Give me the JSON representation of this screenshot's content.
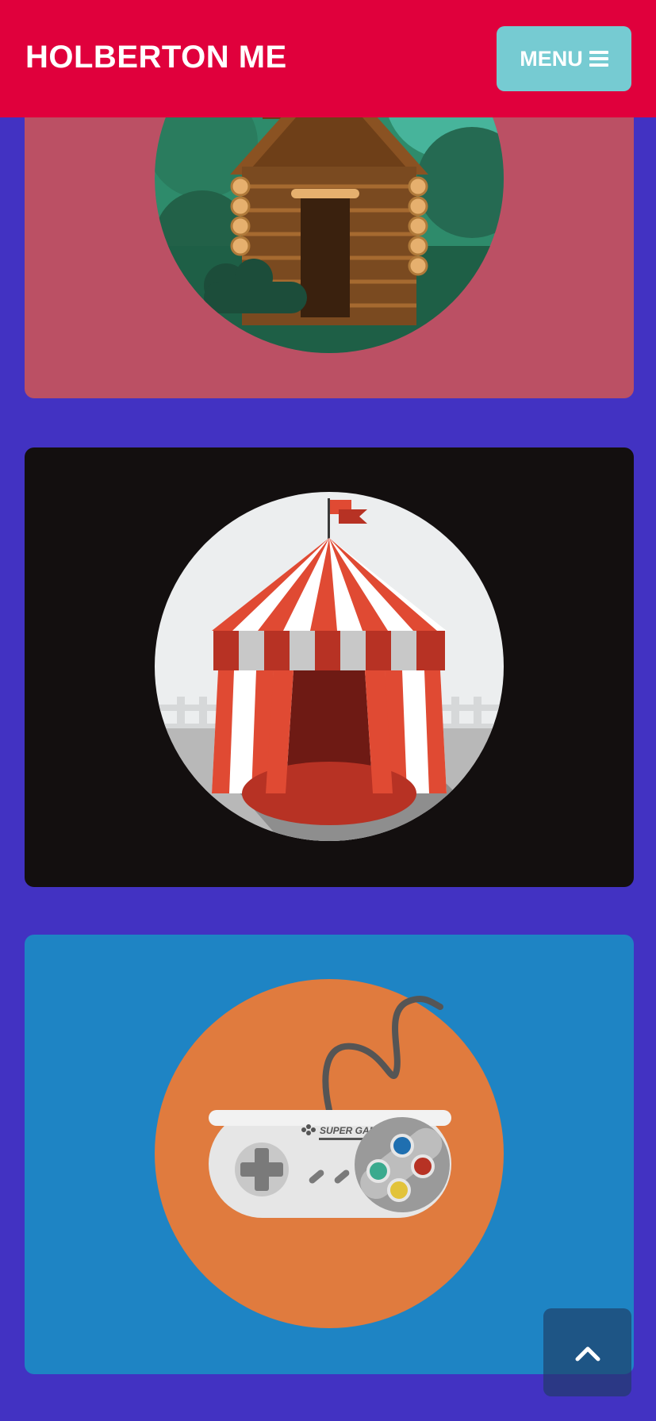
{
  "header": {
    "brand": "HOLBERTON ME",
    "menu_label": "MENU",
    "background": "#e0003c",
    "menu_color": "#76cbd2"
  },
  "page": {
    "background": "#4232c2"
  },
  "cards": [
    {
      "image": "log-cabin-illustration",
      "background": "#bb5064"
    },
    {
      "image": "circus-tent-illustration",
      "background": "#130f0f"
    },
    {
      "image": "game-controller-illustration",
      "background": "#1e84c4"
    }
  ],
  "controller_brand": "SUPER GAME",
  "icons": [
    "hamburger-icon",
    "chevron-up-icon"
  ]
}
